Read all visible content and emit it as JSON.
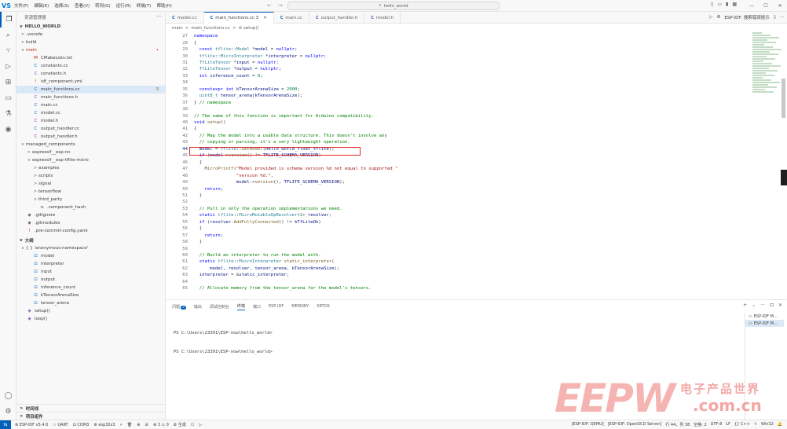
{
  "titlebar": {
    "logo": "VS",
    "menu": [
      "文件(F)",
      "编辑(E)",
      "选择(S)",
      "查看(V)",
      "转到(G)",
      "运行(R)",
      "终端(T)",
      "帮助(H)"
    ],
    "back": "←",
    "forward": "→",
    "search_icon": "⌕",
    "search_text": "hello_world",
    "window_controls": [
      "—",
      "☐",
      "✕"
    ],
    "layout_icons": [
      "▯",
      "▭",
      "▮",
      "▦"
    ]
  },
  "activitybar": {
    "icons": [
      "explorer-icon",
      "search-icon",
      "source-control-icon",
      "run-debug-icon",
      "extensions-icon",
      "remote-icon",
      "test-icon",
      "esp-idf-icon"
    ],
    "glyphs": [
      "❐",
      "⌕",
      "⑂",
      "▷",
      "⊞",
      "▭",
      "⚗",
      "◉"
    ],
    "bottom_glyphs": [
      "◯",
      "⚙"
    ]
  },
  "sidebar": {
    "header": "资源管理器",
    "more": "···",
    "root": "HELLO_WORLD",
    "items": [
      {
        "label": ".vscode",
        "tw": ">",
        "icon": "",
        "depth": 1,
        "color": "c-grey"
      },
      {
        "label": "build",
        "tw": ">",
        "icon": "",
        "depth": 1,
        "color": "c-grey"
      },
      {
        "label": "main",
        "tw": "v",
        "icon": "",
        "depth": 1,
        "color": "c-red",
        "badge": "•"
      },
      {
        "label": "CMakeLists.txt",
        "tw": "",
        "icon": "M",
        "depth": 2,
        "color": "c-red"
      },
      {
        "label": "constants.cc",
        "tw": "",
        "icon": "C",
        "depth": 2,
        "color": "c-blue"
      },
      {
        "label": "constants.h",
        "tw": "",
        "icon": "C",
        "depth": 2,
        "color": "c-purple"
      },
      {
        "label": "idf_component.yml",
        "tw": "",
        "icon": "!",
        "depth": 2,
        "color": "c-red"
      },
      {
        "label": "main_functions.cc",
        "tw": "",
        "icon": "C",
        "depth": 2,
        "color": "c-blue",
        "badge": "3",
        "selected": true
      },
      {
        "label": "main_functions.h",
        "tw": "",
        "icon": "C",
        "depth": 2,
        "color": "c-purple"
      },
      {
        "label": "main.cc",
        "tw": "",
        "icon": "C",
        "depth": 2,
        "color": "c-blue"
      },
      {
        "label": "model.cc",
        "tw": "",
        "icon": "C",
        "depth": 2,
        "color": "c-blue"
      },
      {
        "label": "model.h",
        "tw": "",
        "icon": "C",
        "depth": 2,
        "color": "c-purple"
      },
      {
        "label": "output_handler.cc",
        "tw": "",
        "icon": "C",
        "depth": 2,
        "color": "c-blue"
      },
      {
        "label": "output_handler.h",
        "tw": "",
        "icon": "C",
        "depth": 2,
        "color": "c-purple"
      },
      {
        "label": "managed_components",
        "tw": "v",
        "icon": "",
        "depth": 1,
        "color": "c-grey"
      },
      {
        "label": "espressif__esp-nn",
        "tw": ">",
        "icon": "",
        "depth": 2,
        "color": "c-grey"
      },
      {
        "label": "espressif__esp-tflite-micro",
        "tw": "v",
        "icon": "",
        "depth": 2,
        "color": "c-grey"
      },
      {
        "label": "examples",
        "tw": ">",
        "icon": "",
        "depth": 3,
        "color": "c-grey"
      },
      {
        "label": "scripts",
        "tw": ">",
        "icon": "",
        "depth": 3,
        "color": "c-grey"
      },
      {
        "label": "signal",
        "tw": ">",
        "icon": "",
        "depth": 3,
        "color": "c-grey"
      },
      {
        "label": "tensorflow",
        "tw": ">",
        "icon": "",
        "depth": 3,
        "color": "c-grey"
      },
      {
        "label": "third_party",
        "tw": ">",
        "icon": "",
        "depth": 3,
        "color": "c-grey"
      },
      {
        "label": ".component_hash",
        "tw": "",
        "icon": "≡",
        "depth": 3,
        "color": "c-grey"
      },
      {
        "label": ".gitignore",
        "tw": "",
        "icon": "◆",
        "depth": 1,
        "color": "c-grey"
      },
      {
        "label": ".gitmodules",
        "tw": "",
        "icon": "◆",
        "depth": 1,
        "color": "c-grey"
      },
      {
        "label": ".pre-commit-config.yaml",
        "tw": "",
        "icon": "!",
        "depth": 1,
        "color": "c-red"
      }
    ],
    "outline_title": "大纲",
    "outline": [
      {
        "label": "{ } 'anonymous-namespace'",
        "tw": "v",
        "icon": "",
        "depth": 1,
        "color": "c-grey"
      },
      {
        "label": "model",
        "tw": "",
        "icon": "⊡",
        "depth": 2,
        "color": "c-blue"
      },
      {
        "label": "interpreter",
        "tw": "",
        "icon": "⊡",
        "depth": 2,
        "color": "c-blue"
      },
      {
        "label": "input",
        "tw": "",
        "icon": "⊡",
        "depth": 2,
        "color": "c-blue"
      },
      {
        "label": "output",
        "tw": "",
        "icon": "⊡",
        "depth": 2,
        "color": "c-blue"
      },
      {
        "label": "inference_count",
        "tw": "",
        "icon": "⊡",
        "depth": 2,
        "color": "c-blue"
      },
      {
        "label": "kTensorArenaSize",
        "tw": "",
        "icon": "⊡",
        "depth": 2,
        "color": "c-blue"
      },
      {
        "label": "tensor_arena",
        "tw": "",
        "icon": "⊡",
        "depth": 2,
        "color": "c-blue"
      },
      {
        "label": "setup()",
        "tw": "",
        "icon": "◈",
        "depth": 1,
        "color": "c-purple"
      },
      {
        "label": "loop()",
        "tw": "",
        "icon": "◈",
        "depth": 1,
        "color": "c-purple"
      }
    ],
    "timeline_title": "时间线",
    "projects_title": "项目组件"
  },
  "tabs": [
    {
      "label": "model.cc",
      "kind": "c",
      "active": false
    },
    {
      "label": "main_functions.cc 3",
      "kind": "c",
      "active": true
    },
    {
      "label": "main.cc",
      "kind": "c",
      "active": false
    },
    {
      "label": "output_handler.h",
      "kind": "h",
      "active": false
    },
    {
      "label": "model.h",
      "kind": "h",
      "active": false
    }
  ],
  "tab_tools": {
    "run": "▷",
    "settings": "⚙",
    "idf_label": "ESP-IDF: 搜索错误提示",
    "split": "▯",
    "more": "···"
  },
  "breadcrumbs": [
    "main",
    ">",
    "main_functions.cc",
    ">",
    "⊚ setup()"
  ],
  "code": [
    {
      "ln": "27",
      "html": "<span class='kw'>namespace</span>"
    },
    {
      "ln": "28",
      "html": "{"
    },
    {
      "ln": "29",
      "html": "  <span class='kw'>const</span> <span class='ty'>tflite</span>::<span class='ty'>Model</span> *<span class='va'>model</span> = <span class='kw'>nullptr</span>;"
    },
    {
      "ln": "30",
      "html": "  <span class='ty'>tflite</span>::<span class='ty'>MicroInterpreter</span> *<span class='va'>interpreter</span> = <span class='kw'>nullptr</span>;"
    },
    {
      "ln": "31",
      "html": "  <span class='ty'>TfLiteTensor</span> *<span class='va'>input</span> = <span class='kw'>nullptr</span>;"
    },
    {
      "ln": "32",
      "html": "  <span class='ty'>TfLiteTensor</span> *<span class='va'>output</span> = <span class='kw'>nullptr</span>;"
    },
    {
      "ln": "33",
      "html": "  <span class='kw'>int</span> <span class='va'>inference_count</span> = <span class='nu'>0</span>;"
    },
    {
      "ln": "34",
      "html": ""
    },
    {
      "ln": "35",
      "html": "  <span class='kw'>constexpr</span> <span class='kw'>int</span> <span class='va'>kTensorArenaSize</span> = <span class='nu'>2000</span>;"
    },
    {
      "ln": "36",
      "html": "  <span class='ty'>uint8_t</span> <span class='va'>tensor_arena</span>[<span class='va'>kTensorArenaSize</span>];"
    },
    {
      "ln": "37",
      "html": "} <span class='cm'>// namespace</span>"
    },
    {
      "ln": "38",
      "html": ""
    },
    {
      "ln": "39",
      "html": "<span class='cm'>// The name of this function is important for Arduino compatibility.</span>"
    },
    {
      "ln": "40",
      "html": "<span class='kw'>void</span> <span class='fn'>setup</span>()"
    },
    {
      "ln": "41",
      "html": "{"
    },
    {
      "ln": "42",
      "html": "  <span class='cm'>// Map the model into a usable data structure. This doesn't involve any</span>"
    },
    {
      "ln": "43",
      "html": "  <span class='cm'>// copying or parsing, it's a very lightweight operation.</span>"
    },
    {
      "ln": "44",
      "html": "  <span class='va'>model</span> = <span class='ty'>tflite</span>::<span class='fn'>GetModel</span>(<span class='va'>hello_world_float_tflite</span>);",
      "current": true
    },
    {
      "ln": "45",
      "html": "  <span class='kw'>if</span> (<span class='va'>model</span>-><span class='fn'>version</span>() != <span class='va'>TFLITE_SCHEMA_VERSION</span>)"
    },
    {
      "ln": "46",
      "html": "  {"
    },
    {
      "ln": "47",
      "html": "    <span class='fn'>MicroPrintf</span>(<span class='st'>\"Model provided is schema version %d not equal to supported \"</span>"
    },
    {
      "ln": "48",
      "html": "                <span class='st'>\"version %d.\"</span>,"
    },
    {
      "ln": "49",
      "html": "                <span class='va'>model</span>-><span class='fn'>version</span>(), <span class='va'>TFLITE_SCHEMA_VERSION</span>);"
    },
    {
      "ln": "50",
      "html": "    <span class='kw'>return</span>;"
    },
    {
      "ln": "51",
      "html": "  }"
    },
    {
      "ln": "52",
      "html": ""
    },
    {
      "ln": "53",
      "html": "  <span class='cm'>// Pull in only the operation implementations we need.</span>"
    },
    {
      "ln": "54",
      "html": "  <span class='kw'>static</span> <span class='ty'>tflite</span>::<span class='ty'>MicroMutableOpResolver</span>&lt;<span class='nu'>1</span>&gt; <span class='va'>resolver</span>;"
    },
    {
      "ln": "55",
      "html": "  <span class='kw'>if</span> (<span class='va'>resolver</span>.<span class='fn'>AddFullyConnected</span>() != <span class='va'>kTfLiteOk</span>)"
    },
    {
      "ln": "56",
      "html": "  {"
    },
    {
      "ln": "57",
      "html": "    <span class='kw'>return</span>;"
    },
    {
      "ln": "58",
      "html": "  }"
    },
    {
      "ln": "59",
      "html": ""
    },
    {
      "ln": "60",
      "html": "  <span class='cm'>// Build an interpreter to run the model with.</span>"
    },
    {
      "ln": "61",
      "html": "  <span class='kw'>static</span> <span class='ty'>tflite</span>::<span class='ty'>MicroInterpreter</span> <span class='fn'>static_interpreter</span>("
    },
    {
      "ln": "62",
      "html": "      <span class='va'>model</span>, <span class='va'>resolver</span>, <span class='va'>tensor_arena</span>, <span class='va'>kTensorArenaSize</span>);"
    },
    {
      "ln": "63",
      "html": "  <span class='va'>interpreter</span> = &amp;<span class='va'>static_interpreter</span>;"
    },
    {
      "ln": "64",
      "html": ""
    },
    {
      "ln": "65",
      "html": "  <span class='cm'>// Allocate memory from the tensor_arena for the model's tensors.</span>"
    }
  ],
  "panel": {
    "tabs": [
      "问题",
      "输出",
      "调试控制台",
      "终端",
      "端口",
      "ESP-IDF",
      "MEMORY",
      "XRTOS"
    ],
    "problems_count": "3",
    "active_tab": 3,
    "tools": [
      "+",
      "⌄",
      "···",
      "⊡",
      "✕"
    ],
    "terminal_lines": [
      "PS C:\\Users\\23391\\ESP-now\\hello_world>",
      "PS C:\\Users\\23391\\ESP-now\\hello_world>"
    ],
    "terminals": [
      "ESP-IDF M...",
      "ESP-IDF M..."
    ]
  },
  "watermark": {
    "brand": "EEPW",
    "cn": "电子产品世界",
    "domain": ".com.cn"
  },
  "statusbar": {
    "remote_icon": "⇆",
    "left": [
      "⊗ ESP-IDF v5.4.0",
      "☆ UART",
      "⊡ COM3",
      "⚙ esp32s3",
      "⚡",
      "🗑",
      "⊕",
      "☰",
      "⊗ 3 ⚠ 0",
      "⚙ 生成",
      "☐",
      "▷"
    ],
    "right": [
      "[ESP-IDF: QEMU]",
      "[ESP-IDF: OpenOCD Server]",
      "行 44，列 38",
      "空格: 2",
      "UTF-8",
      "LF",
      "{} C++",
      "⇪",
      "Win32",
      "🔔"
    ]
  }
}
